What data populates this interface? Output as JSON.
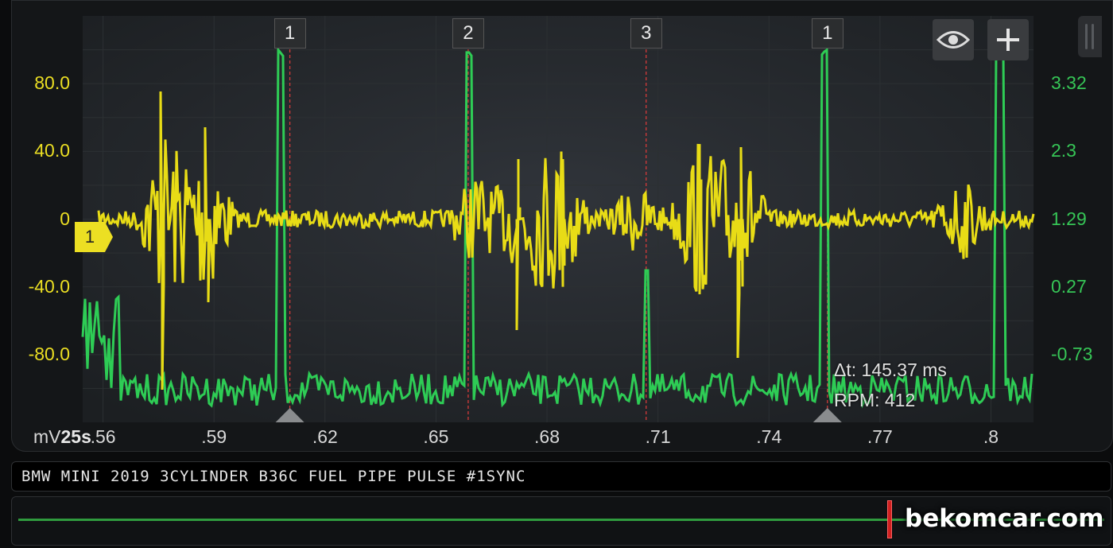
{
  "left_axis": {
    "unit": "mV",
    "color": "#ecdf23",
    "ticks": [
      {
        "label": "80.0",
        "value": 80
      },
      {
        "label": "40.0",
        "value": 40
      },
      {
        "label": "0",
        "value": 0
      },
      {
        "label": "-40.0",
        "value": -40
      },
      {
        "label": "-80.0",
        "value": -80
      }
    ],
    "range": [
      -120,
      120
    ]
  },
  "right_axis": {
    "color": "#36c556",
    "ticks": [
      {
        "label": "3.32",
        "value": 3.32
      },
      {
        "label": "2.3",
        "value": 2.3
      },
      {
        "label": "1.29",
        "value": 1.29
      },
      {
        "label": "0.27",
        "value": 0.27
      },
      {
        "label": "-0.73",
        "value": -0.73
      }
    ]
  },
  "time_axis": {
    "scale_label": "25s",
    "range": [
      0.5545,
      0.8115
    ],
    "ticks": [
      {
        "label": ".56",
        "value": 0.56
      },
      {
        "label": ".59",
        "value": 0.59
      },
      {
        "label": ".62",
        "value": 0.62
      },
      {
        "label": ".65",
        "value": 0.65
      },
      {
        "label": ".68",
        "value": 0.68
      },
      {
        "label": ".71",
        "value": 0.71
      },
      {
        "label": ".74",
        "value": 0.74
      },
      {
        "label": ".77",
        "value": 0.77
      },
      {
        "label": ".8",
        "value": 0.8
      }
    ]
  },
  "markers": [
    {
      "label": "1",
      "t": 0.6105
    },
    {
      "label": "2",
      "t": 0.6587
    },
    {
      "label": "3",
      "t": 0.7068
    },
    {
      "label": "1",
      "t": 0.7558
    }
  ],
  "channel_tag": "1",
  "measurement": {
    "delta": "Δt: 145.37 ms",
    "rpm": "RPM: 412"
  },
  "toolbar": {
    "eye": "eye-icon",
    "add": "plus-icon"
  },
  "title": "BMW MINI 2019 3CYLINDER B36C FUEL PIPE PULSE #1SYNC",
  "watermark": "bekomcar.com",
  "colors": {
    "yellow_trace": "#e8dc16",
    "green_trace": "#2ecc55",
    "marker_line": "#d43a3a",
    "grid": "#2c3033"
  }
}
